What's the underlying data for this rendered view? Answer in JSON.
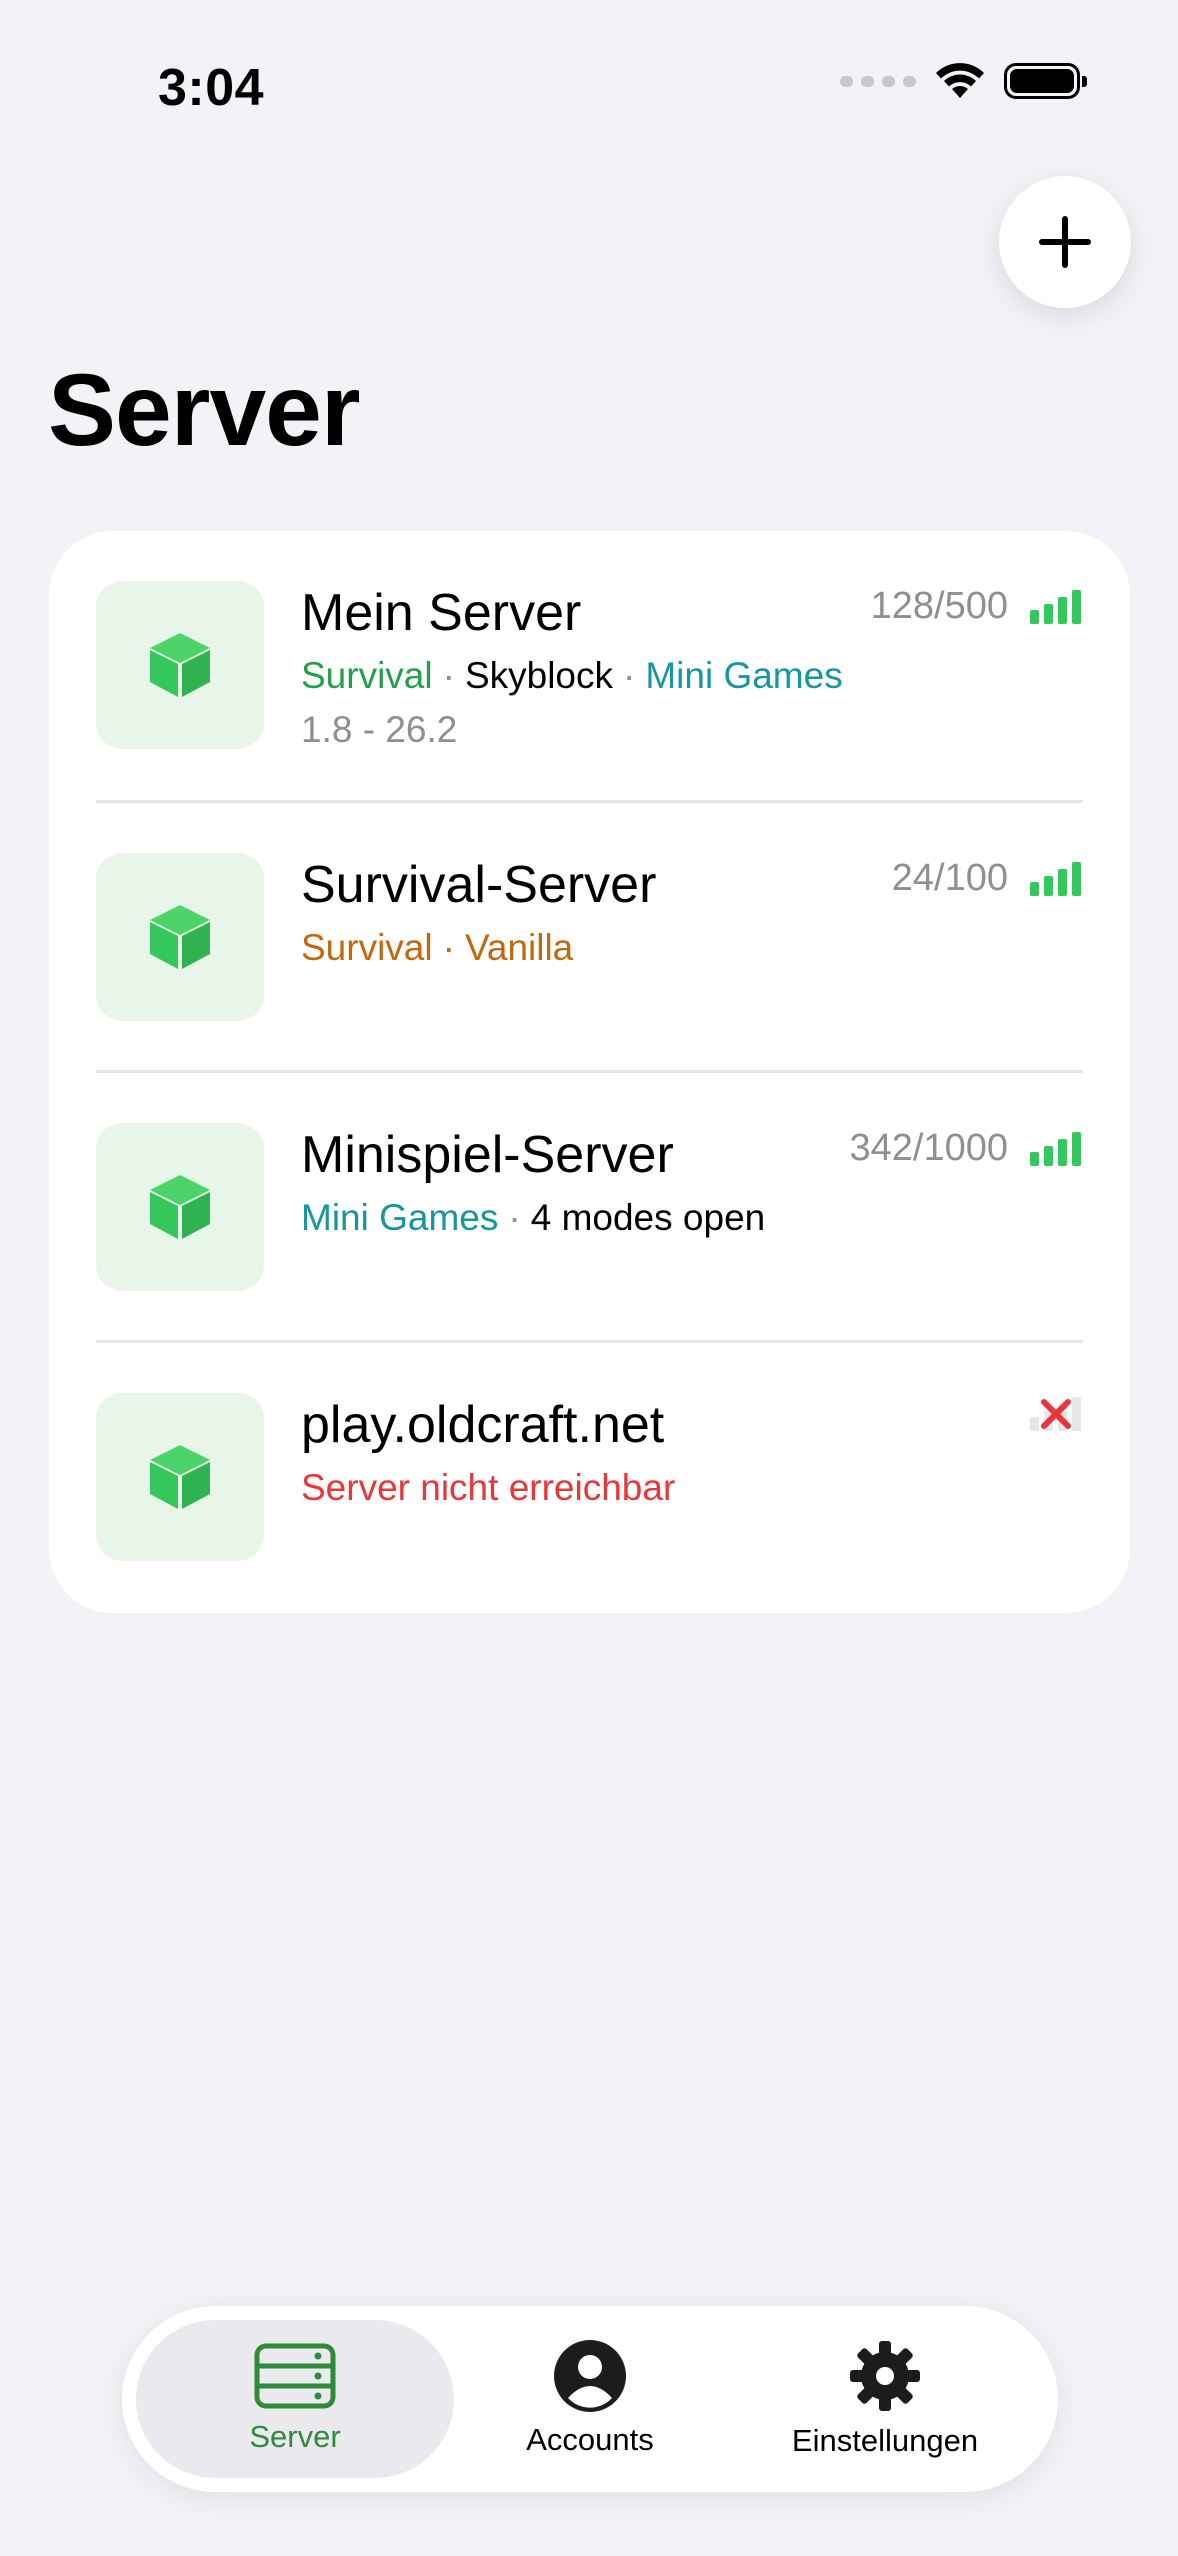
{
  "status_bar": {
    "time": "3:04"
  },
  "page": {
    "title": "Server"
  },
  "colors": {
    "accent_green": "#2F8A3A",
    "online_green": "#34C759",
    "error_red": "#E8373A",
    "tag_teal": "#16969E",
    "tag_orange": "#C2690F"
  },
  "servers": [
    {
      "name": "Mein Server",
      "players": "128/500",
      "status": "online",
      "tags": [
        {
          "text": "Survival",
          "style": "green"
        },
        {
          "text": "Skyblock",
          "style": "black"
        },
        {
          "text": "Mini Games",
          "style": "teal"
        }
      ],
      "version": "1.8 - 26.2"
    },
    {
      "name": "Survival-Server",
      "players": "24/100",
      "status": "online",
      "tags": [
        {
          "text": "Survival",
          "style": "orange"
        },
        {
          "text": "Vanilla",
          "style": "orange"
        }
      ]
    },
    {
      "name": "Minispiel-Server",
      "players": "342/1000",
      "status": "online",
      "tags": [
        {
          "text": "Mini Games",
          "style": "teal"
        },
        {
          "text": "4 modes open",
          "style": "plain"
        }
      ]
    },
    {
      "name": "play.oldcraft.net",
      "status": "offline",
      "error": "Server nicht erreichbar"
    }
  ],
  "tabbar": {
    "items": [
      {
        "label": "Server",
        "icon": "server-icon",
        "active": true
      },
      {
        "label": "Accounts",
        "icon": "person-icon",
        "active": false
      },
      {
        "label": "Einstellungen",
        "icon": "gear-icon",
        "active": false
      }
    ]
  }
}
